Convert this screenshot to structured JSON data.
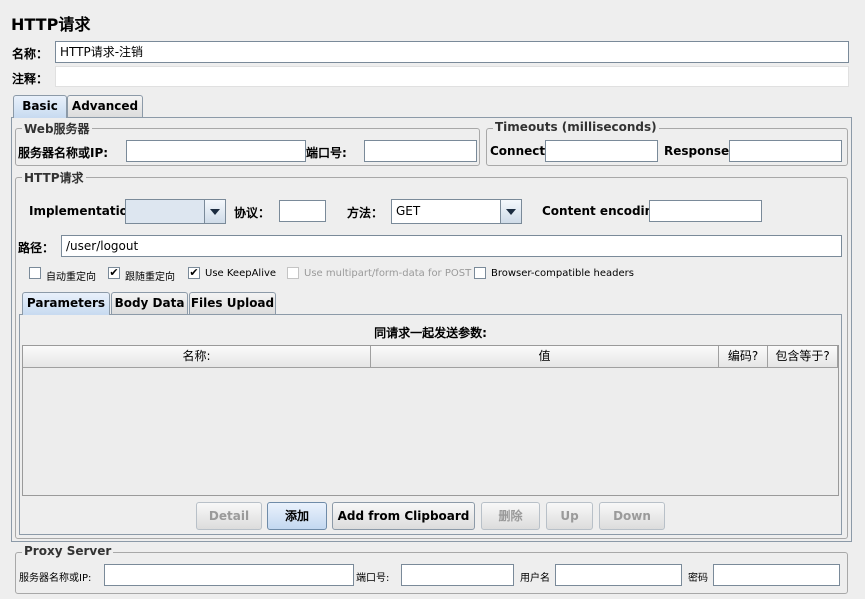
{
  "page": {
    "title": "HTTP请求"
  },
  "name": {
    "label": "名称：",
    "value": "HTTP请求-注销"
  },
  "comments": {
    "label": "注释：",
    "value": ""
  },
  "top_tabs": {
    "basic": "Basic",
    "advanced": "Advanced"
  },
  "web_server": {
    "title": "Web服务器",
    "server_label": "服务器名称或IP:",
    "server_value": "",
    "port_label": "端口号:",
    "port_value": ""
  },
  "timeouts": {
    "title": "Timeouts (milliseconds)",
    "connect_label": "Connect:",
    "connect_value": "",
    "response_label": "Response:",
    "response_value": ""
  },
  "http_request": {
    "title": "HTTP请求",
    "implementation_label": "Implementation:",
    "implementation_value": "",
    "protocol_label": "协议：",
    "protocol_value": "",
    "method_label": "方法：",
    "method_value": "GET",
    "encoding_label": "Content encoding:",
    "encoding_value": "",
    "path_label": "路径：",
    "path_value": "/user/logout"
  },
  "options": {
    "auto_redirect": {
      "label": "自动重定向",
      "checked": false
    },
    "follow_redirects": {
      "label": "跟随重定向",
      "checked": true
    },
    "keepalive": {
      "label": "Use KeepAlive",
      "checked": true
    },
    "multipart": {
      "label": "Use multipart/form-data for POST",
      "checked": false,
      "disabled": true
    },
    "browser_headers": {
      "label": "Browser-compatible headers",
      "checked": false
    },
    "check_mark": "✔"
  },
  "inner_tabs": {
    "parameters": "Parameters",
    "body_data": "Body Data",
    "files_upload": "Files Upload"
  },
  "params": {
    "caption": "同请求一起发送参数:",
    "columns": {
      "name": "名称:",
      "value": "值",
      "encode": "编码?",
      "include_equals": "包含等于?"
    }
  },
  "buttons": {
    "detail": "Detail",
    "add": "添加",
    "add_clipboard": "Add from Clipboard",
    "delete": "删除",
    "up": "Up",
    "down": "Down"
  },
  "proxy": {
    "title": "Proxy Server",
    "server_label": "服务器名称或IP:",
    "server_value": "",
    "port_label": "端口号:",
    "port_value": "",
    "username_label": "用户名",
    "username_value": "",
    "password_label": "密码",
    "password_value": ""
  },
  "icons": {
    "dropdown": "chevron-down-icon"
  },
  "colors": {
    "active_tab": "#c7daf0",
    "panel_border": "#8c9aa8"
  }
}
